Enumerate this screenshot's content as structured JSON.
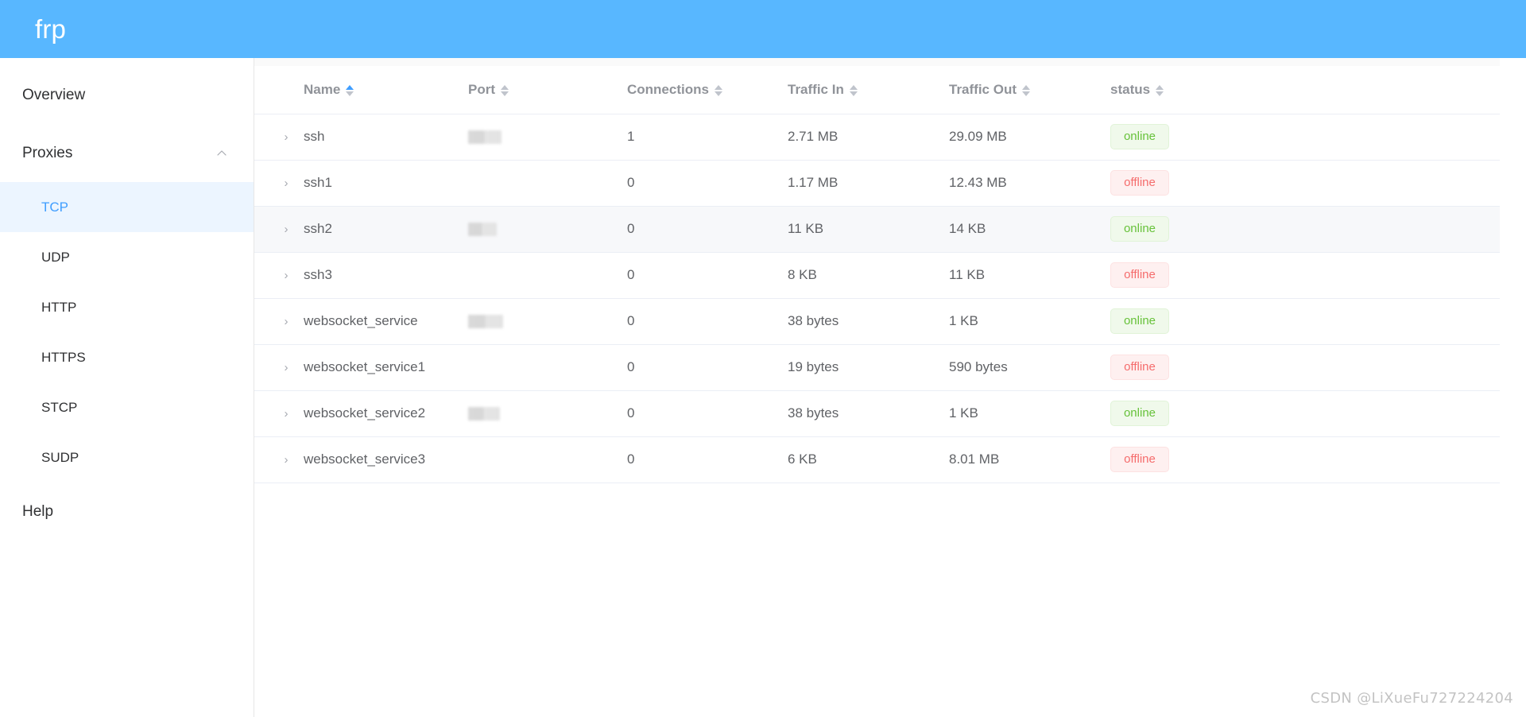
{
  "header": {
    "brand": "frp"
  },
  "sidebar": {
    "items": [
      {
        "label": "Overview",
        "type": "link",
        "active": false
      },
      {
        "label": "Proxies",
        "type": "group",
        "expanded": true,
        "icon": "chevron-up-icon"
      },
      {
        "label": "Help",
        "type": "link",
        "active": false
      }
    ],
    "proxy_children": [
      {
        "label": "TCP",
        "active": true
      },
      {
        "label": "UDP",
        "active": false
      },
      {
        "label": "HTTP",
        "active": false
      },
      {
        "label": "HTTPS",
        "active": false
      },
      {
        "label": "STCP",
        "active": false
      },
      {
        "label": "SUDP",
        "active": false
      }
    ]
  },
  "table": {
    "columns": [
      {
        "key": "name",
        "label": "Name",
        "sortable": true,
        "sort_active": "asc"
      },
      {
        "key": "port",
        "label": "Port",
        "sortable": true,
        "sort_active": "none"
      },
      {
        "key": "connections",
        "label": "Connections",
        "sortable": true,
        "sort_active": "none"
      },
      {
        "key": "traffic_in",
        "label": "Traffic In",
        "sortable": true,
        "sort_active": "none"
      },
      {
        "key": "traffic_out",
        "label": "Traffic Out",
        "sortable": true,
        "sort_active": "none"
      },
      {
        "key": "status",
        "label": "status",
        "sortable": true,
        "sort_active": "none"
      }
    ],
    "rows": [
      {
        "name": "ssh",
        "port": "",
        "port_redacted": true,
        "connections": "1",
        "traffic_in": "2.71 MB",
        "traffic_out": "29.09 MB",
        "status": "online"
      },
      {
        "name": "ssh1",
        "port": "",
        "port_redacted": false,
        "connections": "0",
        "traffic_in": "1.17 MB",
        "traffic_out": "12.43 MB",
        "status": "offline"
      },
      {
        "name": "ssh2",
        "port": "",
        "port_redacted": true,
        "connections": "0",
        "traffic_in": "11 KB",
        "traffic_out": "14 KB",
        "status": "online"
      },
      {
        "name": "ssh3",
        "port": "",
        "port_redacted": false,
        "connections": "0",
        "traffic_in": "8 KB",
        "traffic_out": "11 KB",
        "status": "offline"
      },
      {
        "name": "websocket_service",
        "port": "",
        "port_redacted": true,
        "connections": "0",
        "traffic_in": "38 bytes",
        "traffic_out": "1 KB",
        "status": "online"
      },
      {
        "name": "websocket_service1",
        "port": "",
        "port_redacted": false,
        "connections": "0",
        "traffic_in": "19 bytes",
        "traffic_out": "590 bytes",
        "status": "offline"
      },
      {
        "name": "websocket_service2",
        "port": "",
        "port_redacted": true,
        "connections": "0",
        "traffic_in": "38 bytes",
        "traffic_out": "1 KB",
        "status": "online"
      },
      {
        "name": "websocket_service3",
        "port": "",
        "port_redacted": false,
        "connections": "0",
        "traffic_in": "6 KB",
        "traffic_out": "8.01 MB",
        "status": "offline"
      }
    ],
    "expand_icon": "chevron-right-icon"
  },
  "watermark": "CSDN @LiXueFu727224204",
  "colors": {
    "header_blue": "#58b7ff",
    "accent": "#409eff",
    "active_bg": "#ecf5ff",
    "online_text": "#67c23a",
    "online_bg": "#f0f9eb",
    "offline_text": "#f56c6c",
    "offline_bg": "#fef0f0"
  }
}
